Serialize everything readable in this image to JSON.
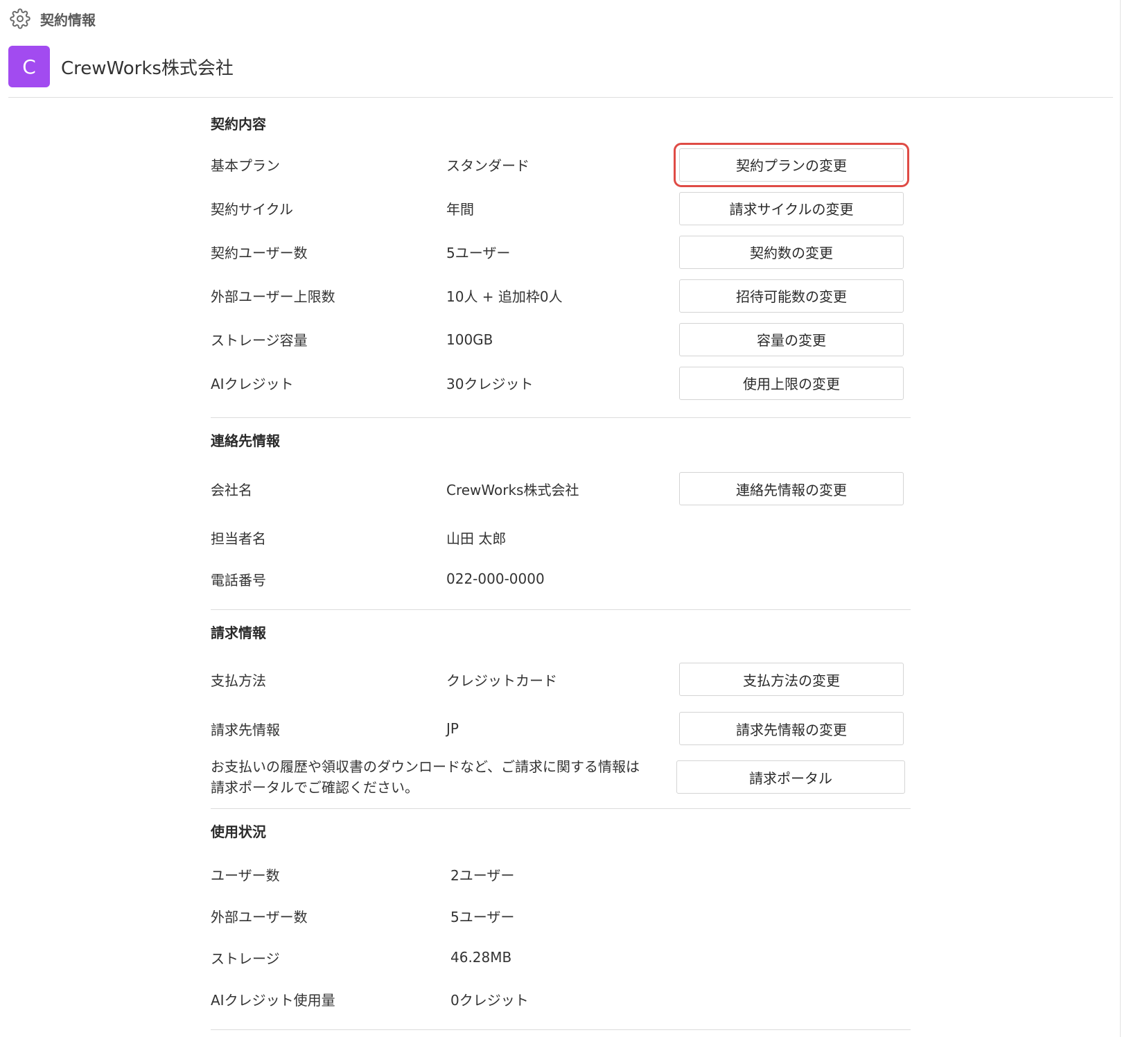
{
  "breadcrumb": {
    "icon": "gear-icon",
    "label": "契約情報"
  },
  "organization": {
    "avatar_letter": "C",
    "avatar_color": "#a24bf0",
    "name": "CrewWorks株式会社"
  },
  "contract": {
    "title": "契約内容",
    "rows": [
      {
        "label": "基本プラン",
        "value": "スタンダード",
        "action": "契約プランの変更"
      },
      {
        "label": "契約サイクル",
        "value": "年間",
        "action": "請求サイクルの変更"
      },
      {
        "label": "契約ユーザー数",
        "value": "5ユーザー",
        "action": "契約数の変更"
      },
      {
        "label": "外部ユーザー上限数",
        "value": "10人 + 追加枠0人",
        "action": "招待可能数の変更"
      },
      {
        "label": "ストレージ容量",
        "value": "100GB",
        "action": "容量の変更"
      },
      {
        "label": "AIクレジット",
        "value": "30クレジット",
        "action": "使用上限の変更"
      }
    ]
  },
  "contact": {
    "title": "連絡先情報",
    "company": {
      "label": "会社名",
      "value": "CrewWorks株式会社",
      "action": "連絡先情報の変更"
    },
    "person": {
      "label": "担当者名",
      "value": "山田 太郎"
    },
    "phone": {
      "label": "電話番号",
      "value": "022-000-0000"
    }
  },
  "billing": {
    "title": "請求情報",
    "payment": {
      "label": "支払方法",
      "value": "クレジットカード",
      "action": "支払方法の変更"
    },
    "billto": {
      "label": "請求先情報",
      "value": "JP",
      "action": "請求先情報の変更"
    },
    "portal_note_line1": "お支払いの履歴や領収書のダウンロードなど、ご請求に関する情報は",
    "portal_note_line2": "請求ポータルでご確認ください。",
    "portal_action": "請求ポータル"
  },
  "usage": {
    "title": "使用状況",
    "rows": [
      {
        "label": "ユーザー数",
        "value": "2ユーザー"
      },
      {
        "label": "外部ユーザー数",
        "value": "5ユーザー"
      },
      {
        "label": "ストレージ",
        "value": "46.28MB"
      },
      {
        "label": "AIクレジット使用量",
        "value": "0クレジット"
      }
    ]
  },
  "colors": {
    "accent": "#a24bf0",
    "highlight": "#df4b45"
  }
}
